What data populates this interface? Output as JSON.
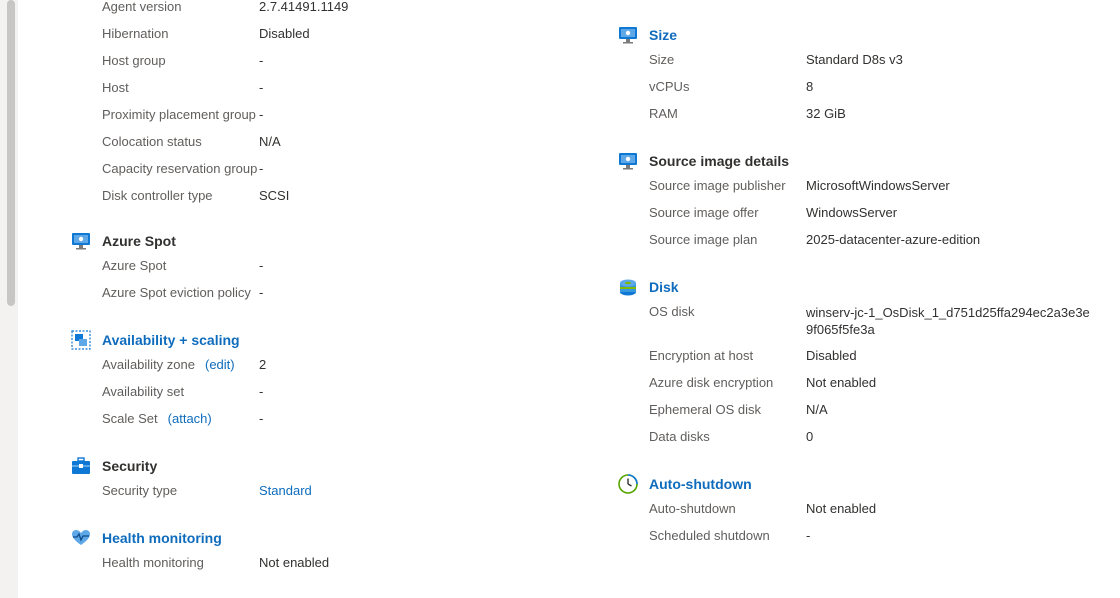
{
  "left": {
    "top_rows": [
      {
        "label": "Agent version",
        "value": "2.7.41491.1149"
      },
      {
        "label": "Hibernation",
        "value": "Disabled"
      },
      {
        "label": "Host group",
        "value": "-"
      },
      {
        "label": "Host",
        "value": "-"
      },
      {
        "label": "Proximity placement group",
        "value": "-"
      },
      {
        "label": "Colocation status",
        "value": "N/A"
      },
      {
        "label": "Capacity reservation group",
        "value": "-"
      },
      {
        "label": "Disk controller type",
        "value": "SCSI"
      }
    ],
    "azure_spot": {
      "title": "Azure Spot",
      "icon": "monitor-icon",
      "rows": [
        {
          "label": "Azure Spot",
          "value": "-"
        },
        {
          "label": "Azure Spot eviction policy",
          "value": "-"
        }
      ]
    },
    "availability": {
      "title": "Availability + scaling",
      "icon": "availability-icon",
      "rows": [
        {
          "label": "Availability zone",
          "action": "(edit)",
          "value": "2"
        },
        {
          "label": "Availability set",
          "value": "-"
        },
        {
          "label": "Scale Set",
          "action": "(attach)",
          "value": "-"
        }
      ]
    },
    "security": {
      "title": "Security",
      "icon": "toolbox-icon",
      "rows": [
        {
          "label": "Security type",
          "value": "Standard"
        }
      ]
    },
    "health": {
      "title": "Health monitoring",
      "icon": "heart-pulse-icon",
      "rows": [
        {
          "label": "Health monitoring",
          "value": "Not enabled"
        }
      ]
    }
  },
  "right": {
    "size": {
      "title": "Size",
      "icon": "monitor-icon",
      "rows": [
        {
          "label": "Size",
          "value": "Standard D8s v3"
        },
        {
          "label": "vCPUs",
          "value": "8"
        },
        {
          "label": "RAM",
          "value": "32 GiB"
        }
      ]
    },
    "source_image": {
      "title": "Source image details",
      "icon": "monitor-icon",
      "rows": [
        {
          "label": "Source image publisher",
          "value": "MicrosoftWindowsServer"
        },
        {
          "label": "Source image offer",
          "value": "WindowsServer"
        },
        {
          "label": "Source image plan",
          "value": "2025-datacenter-azure-edition"
        }
      ]
    },
    "disk": {
      "title": "Disk",
      "icon": "disk-icon",
      "os_disk_label": "OS disk",
      "os_disk_value": "winserv-jc-1_OsDisk_1_d751d25ffa294ec2a3e3e9f065f5fe3a",
      "rows": [
        {
          "label": "Encryption at host",
          "value": "Disabled"
        },
        {
          "label": "Azure disk encryption",
          "value": "Not enabled"
        },
        {
          "label": "Ephemeral OS disk",
          "value": "N/A"
        },
        {
          "label": "Data disks",
          "value": "0"
        }
      ]
    },
    "autoshutdown": {
      "title": "Auto-shutdown",
      "icon": "clock-icon",
      "rows": [
        {
          "label": "Auto-shutdown",
          "value": "Not enabled"
        },
        {
          "label": "Scheduled shutdown",
          "value": "-"
        }
      ]
    }
  },
  "colors": {
    "link": "#0f6cbd",
    "label": "#605e5c",
    "text": "#323130"
  }
}
